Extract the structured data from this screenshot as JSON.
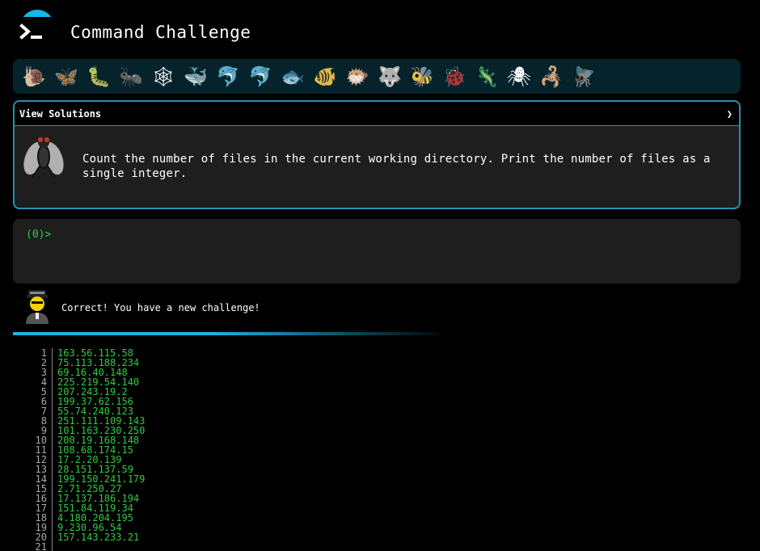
{
  "app": {
    "title": "Command Challenge"
  },
  "animals": [
    {
      "name": "snail-icon",
      "glyph": "🐌"
    },
    {
      "name": "butterfly-icon",
      "glyph": "🦋"
    },
    {
      "name": "caterpillar-icon",
      "glyph": "🐛"
    },
    {
      "name": "ant-icon",
      "glyph": "🐜"
    },
    {
      "name": "spider-web-icon",
      "glyph": "🕸"
    },
    {
      "name": "whale-icon",
      "glyph": "🐳"
    },
    {
      "name": "dolphin-icon",
      "glyph": "🐬"
    },
    {
      "name": "dolphin-gray-icon",
      "glyph": "🐬"
    },
    {
      "name": "fish-icon",
      "glyph": "🐟"
    },
    {
      "name": "tropical-fish-icon",
      "glyph": "🐠"
    },
    {
      "name": "blowfish-icon",
      "glyph": "🐡"
    },
    {
      "name": "wolf-icon",
      "glyph": "🐺"
    },
    {
      "name": "bee-icon",
      "glyph": "🐝"
    },
    {
      "name": "ladybug-icon",
      "glyph": "🐞"
    },
    {
      "name": "lizard-icon",
      "glyph": "🦎"
    },
    {
      "name": "spider-icon",
      "glyph": "🕷"
    },
    {
      "name": "scorpion-icon",
      "glyph": "🦂"
    },
    {
      "name": "fly-icon",
      "glyph": "🪰"
    }
  ],
  "solutions_panel": {
    "header": "View Solutions",
    "chevron": "❯",
    "challenge": "Count the number of files in the current working directory. Print the number of files as a single integer."
  },
  "terminal": {
    "prompt": "(0)>"
  },
  "feedback": {
    "message": "Correct! You have a new challenge!"
  },
  "progress": {
    "fraction": 0.58
  },
  "editor": {
    "line_numbers": [
      "1",
      "2",
      "3",
      "4",
      "5",
      "6",
      "7",
      "8",
      "9",
      "10",
      "11",
      "12",
      "13",
      "14",
      "15",
      "16",
      "17",
      "18",
      "19",
      "20",
      "21"
    ],
    "lines": [
      "163.56.115.58",
      "75.113.188.234",
      "69.16.40.148",
      "225.219.54.140",
      "207.243.19.2",
      "199.37.62.156",
      "55.74.240.123",
      "251.111.109.143",
      "101.163.230.250",
      "200.19.168.148",
      "108.68.174.15",
      "17.2.20.139",
      "28.151.137.59",
      "199.150.241.179",
      "2.71.250.27",
      "17.137.186.194",
      "151.84.119.34",
      "4.180.204.195",
      "9.230.96.54",
      "157.143.233.21",
      ""
    ]
  },
  "colors": {
    "accent": "#15b8ec",
    "panel_border": "#2a8fb0",
    "prompt_green": "#2ecc40",
    "terminal_bg": "#1e1e1e",
    "animal_bar_bg": "#06222b"
  }
}
